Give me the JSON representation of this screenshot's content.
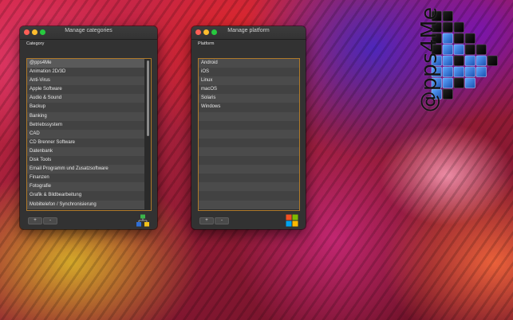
{
  "brand": {
    "text": "@pps4Me"
  },
  "categories_window": {
    "title": "Manage categories",
    "section_label": "Category",
    "items": [
      "@pps4Me",
      "Animation 2D/3D",
      "Anti-Virus",
      "Apple Software",
      "Audio & Sound",
      "Backup",
      "Banking",
      "Betriebssystem",
      "CAD",
      "CD Brenner Software",
      "Datenbank",
      "Disk Tools",
      "Email Programm und Zusatzsoftware",
      "Finanzen",
      "Fotografie",
      "Grafik & Bildbearbeitung",
      "Mobiltelefon / Synchronisierung"
    ],
    "add_label": "+",
    "remove_label": "-"
  },
  "platform_window": {
    "title": "Manage platform",
    "section_label": "Platform",
    "items": [
      "Android",
      "iOS",
      "Linux",
      "macOS",
      "Solaris",
      "Windows"
    ],
    "empty_rows": 11,
    "add_label": "+",
    "remove_label": "-"
  },
  "colors": {
    "window_bg": "#323232",
    "list_border": "#b07a2a",
    "close": "#ff5f56",
    "minimize": "#ffbd2e",
    "maximize": "#27c93f"
  },
  "icons": {
    "categories_window_icon": "colored-blocks-tree-icon",
    "platform_window_icon": "windows-colored-flag-icon",
    "brand_logo": "pixel-block-a-logo"
  }
}
